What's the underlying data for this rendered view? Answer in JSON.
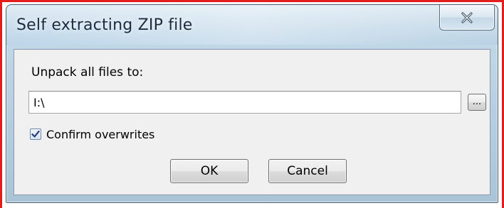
{
  "window": {
    "title": "Self extracting ZIP file"
  },
  "form": {
    "unpack_label": "Unpack all files to:",
    "path_value": "I:\\",
    "browse_label": "...",
    "confirm_label": "Confirm overwrites",
    "confirm_checked": true
  },
  "buttons": {
    "ok_label": "OK",
    "cancel_label": "Cancel"
  },
  "icons": {
    "close": "close-icon",
    "checkmark": "checkmark-icon"
  },
  "colors": {
    "frame_red": "#e31c1c",
    "titlebar": "#bcd5e8",
    "client_bg": "#f0f0f0",
    "checkmark": "#2a3f7a"
  }
}
